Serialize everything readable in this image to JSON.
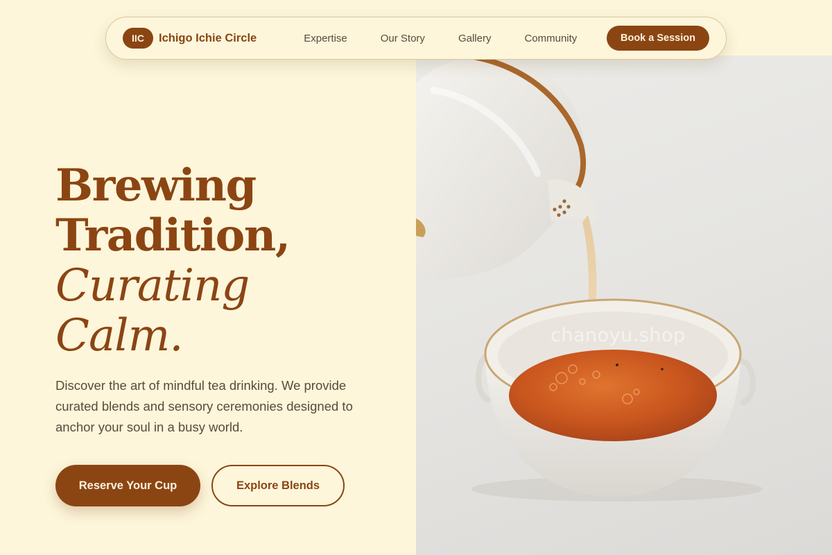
{
  "nav": {
    "logo_badge": "IIC",
    "brand_name": "Ichigo Ichie Circle",
    "links": [
      {
        "label": "Expertise"
      },
      {
        "label": "Our Story"
      },
      {
        "label": "Gallery"
      },
      {
        "label": "Community"
      }
    ],
    "cta_label": "Book a Session"
  },
  "hero": {
    "title_line_1": "Brewing",
    "title_line_2": "Tradition,",
    "title_line_3": "Curating",
    "title_line_4": "Calm.",
    "description": "Discover the art of mindful tea drinking. We provide curated blends and sensory ceremonies designed to anchor your soul in a busy world.",
    "primary_button": "Reserve Your Cup",
    "secondary_button": "Explore Blends"
  },
  "photo": {
    "watermark": "chanoyu.shop"
  },
  "colors": {
    "page_bg": "#fdf6db",
    "brand_brown": "#8b4513",
    "body_text": "#5b4a3a",
    "tea": "#c8541f"
  }
}
